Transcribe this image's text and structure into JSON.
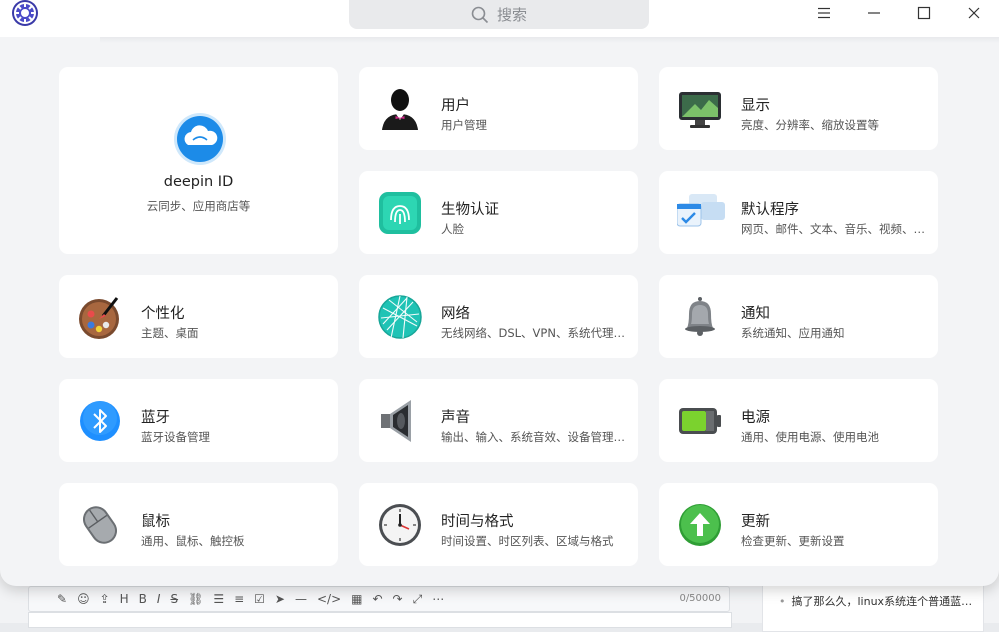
{
  "search": {
    "placeholder": "搜索"
  },
  "window_controls": [
    "menu-icon",
    "minimize-icon",
    "maximize-icon",
    "close-icon"
  ],
  "account": {
    "title": "deepin ID",
    "subtitle": "云同步、应用商店等"
  },
  "modules": [
    {
      "title": "用户",
      "subtitle": "用户管理",
      "icon": "user-icon"
    },
    {
      "title": "显示",
      "subtitle": "亮度、分辨率、缩放设置等",
      "icon": "display-icon"
    },
    {
      "title": "生物认证",
      "subtitle": "人脸",
      "icon": "fingerprint-icon"
    },
    {
      "title": "默认程序",
      "subtitle": "网页、邮件、文本、音乐、视频、…",
      "icon": "default-apps-icon"
    },
    {
      "title": "个性化",
      "subtitle": "主题、桌面",
      "icon": "palette-icon"
    },
    {
      "title": "网络",
      "subtitle": "无线网络、DSL、VPN、系统代理、…",
      "icon": "network-globe-icon"
    },
    {
      "title": "通知",
      "subtitle": "系统通知、应用通知",
      "icon": "bell-icon"
    },
    {
      "title": "蓝牙",
      "subtitle": "蓝牙设备管理",
      "icon": "bluetooth-icon"
    },
    {
      "title": "声音",
      "subtitle": "输出、输入、系统音效、设备管理…",
      "icon": "speaker-icon"
    },
    {
      "title": "电源",
      "subtitle": "通用、使用电源、使用电池",
      "icon": "battery-icon"
    },
    {
      "title": "鼠标",
      "subtitle": "通用、鼠标、触控板",
      "icon": "mouse-icon"
    },
    {
      "title": "时间与格式",
      "subtitle": "时间设置、时区列表、区域与格式",
      "icon": "clock-icon"
    },
    {
      "title": "更新",
      "subtitle": "检查更新、更新设置",
      "icon": "update-arrow-icon"
    }
  ],
  "background": {
    "editor_counter": "0/50000",
    "sidebar_post": "搞了那么久，linux系统连个普通蓝…"
  },
  "colors": {
    "window_bg": "#f3f4f6",
    "card_bg": "#ffffff",
    "accent_blue": "#1e90ff",
    "update_green": "#3bb33b"
  }
}
